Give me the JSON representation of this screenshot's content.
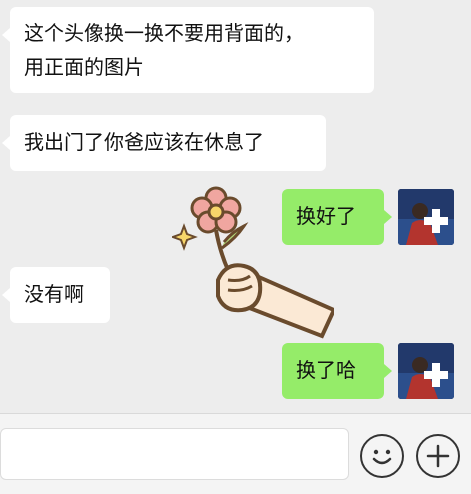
{
  "messages": [
    {
      "side": "left",
      "lines": [
        "这个头像换一换不要用背面的，",
        "用正面的图片"
      ]
    },
    {
      "side": "left",
      "lines": [
        "我出门了你爸应该在休息了"
      ]
    },
    {
      "side": "right",
      "lines": [
        "换好了"
      ]
    },
    {
      "side": "left",
      "lines": [
        "没有啊"
      ]
    },
    {
      "side": "right",
      "lines": [
        "换了哈"
      ]
    }
  ],
  "sticker": {
    "name": "flower-hand-sticker"
  },
  "input": {
    "placeholder": ""
  },
  "icons": {
    "emoji": "smiley-icon",
    "add": "plus-icon"
  },
  "colors": {
    "background": "#ededed",
    "left_bubble": "#ffffff",
    "right_bubble": "#95ec69"
  }
}
